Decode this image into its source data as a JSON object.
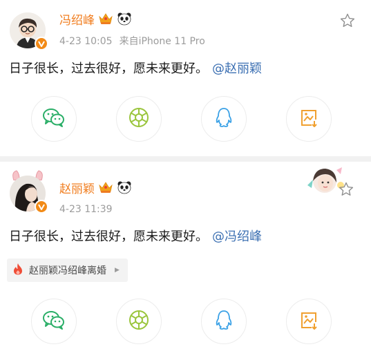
{
  "posts": [
    {
      "username": "冯绍峰",
      "date": "4-23 10:05",
      "source": "来自iPhone 11 Pro",
      "text": "日子很长，过去很好，愿未来更好。",
      "mention": "@赵丽颖",
      "icons": [
        "verified-v-icon",
        "crown-icon",
        "panda-icon",
        "star-icon"
      ],
      "share_buttons": [
        "wechat",
        "moments",
        "qq",
        "save-image"
      ]
    },
    {
      "username": "赵丽颖",
      "date": "4-23 11:39",
      "text": "日子很长，过去很好，愿未来更好。",
      "mention": "@冯绍峰",
      "topic": "赵丽颖冯绍峰离婚",
      "icons": [
        "verified-v-icon",
        "crown-icon",
        "panda-icon",
        "star-icon",
        "fire-icon"
      ],
      "share_buttons": [
        "wechat",
        "moments",
        "qq",
        "save-image"
      ]
    }
  ],
  "colors": {
    "username": "#f17d1e",
    "meta": "#9b9b9b",
    "mention": "#3b6fb2",
    "wechat": "#2aae67",
    "moments": "#9ac53c",
    "qq": "#3aa1e6",
    "save": "#f0a030",
    "fire": "#ef4c36"
  }
}
